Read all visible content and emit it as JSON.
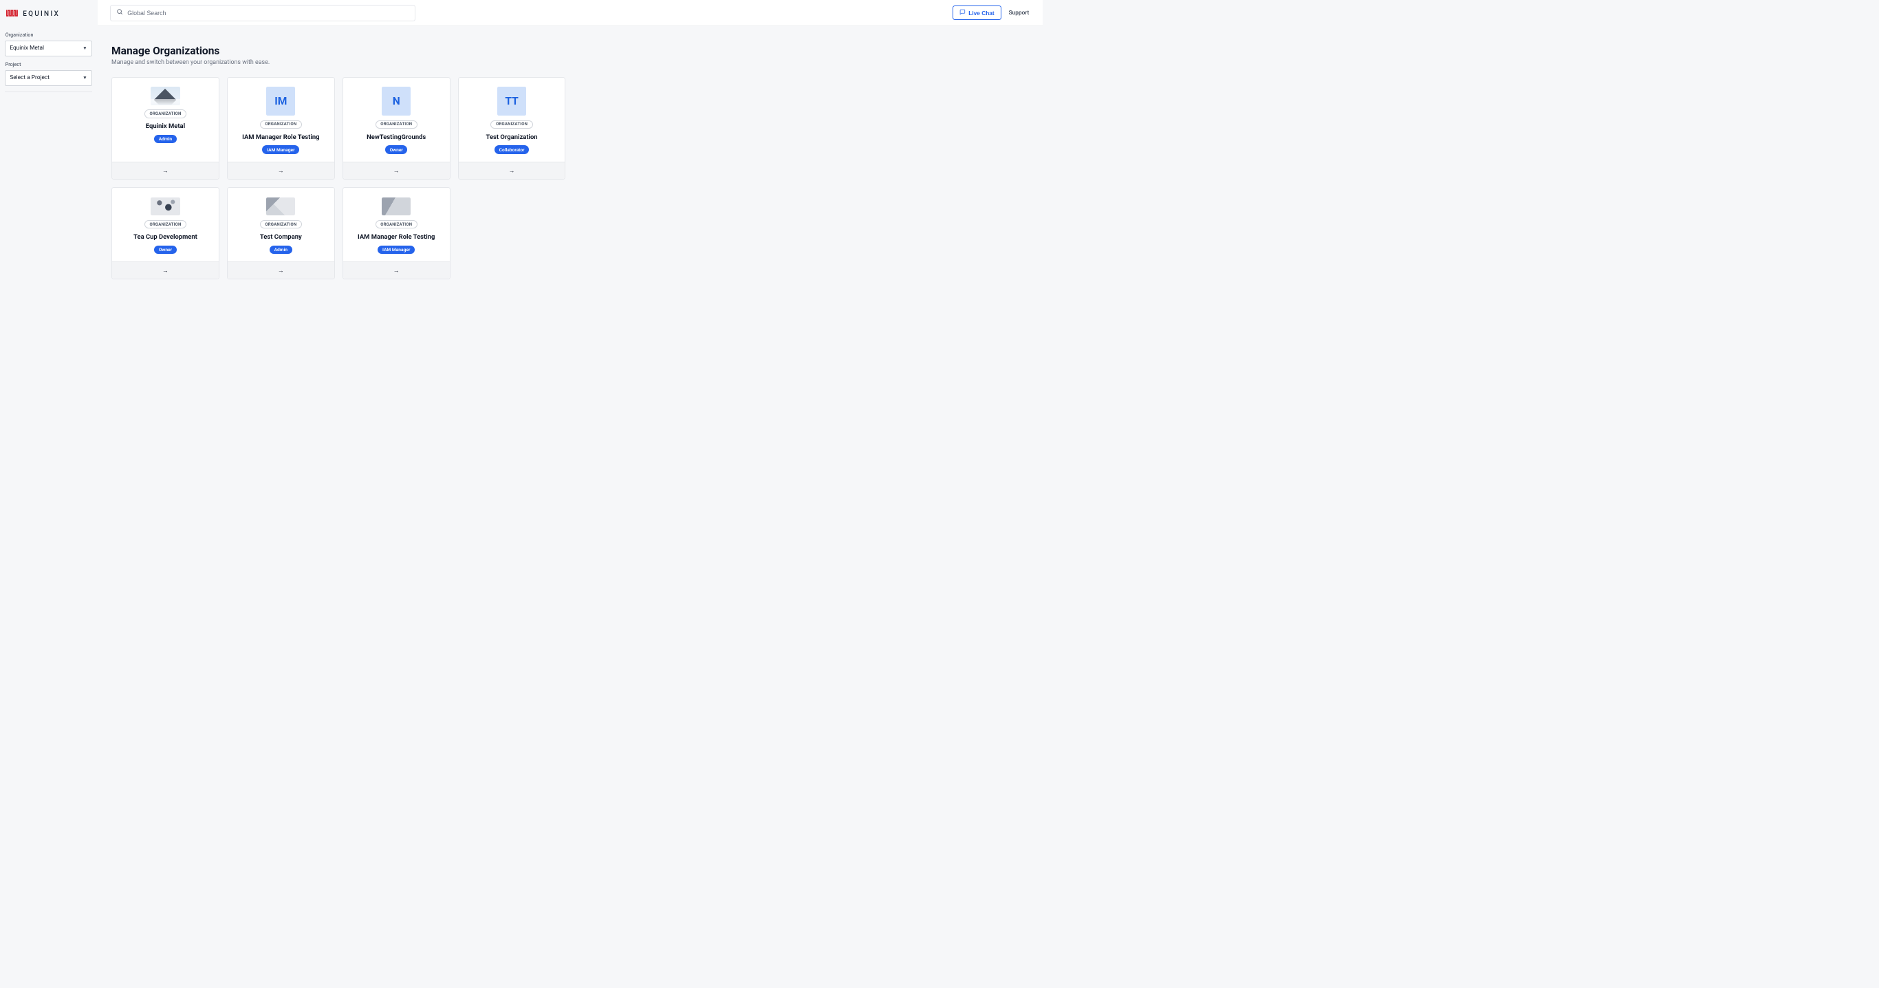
{
  "brand": {
    "name": "EQUINIX"
  },
  "sidebar": {
    "org_label": "Organization",
    "org_selected": "Equinix Metal",
    "project_label": "Project",
    "project_selected": "Select a Project"
  },
  "topbar": {
    "search_placeholder": "Global Search",
    "live_chat": "Live Chat",
    "support": "Support"
  },
  "page": {
    "title": "Manage Organizations",
    "subtitle": "Manage and switch between your organizations with ease."
  },
  "labels": {
    "type_badge": "ORGANIZATION"
  },
  "orgs": [
    {
      "name": "Equinix Metal",
      "role": "Admin",
      "thumb_kind": "image",
      "thumb_class": "mountain",
      "initials": ""
    },
    {
      "name": "IAM Manager Role Testing",
      "role": "IAM Manager",
      "thumb_kind": "initials",
      "thumb_class": "",
      "initials": "IM"
    },
    {
      "name": "NewTestingGrounds",
      "role": "Owner",
      "thumb_kind": "initials",
      "thumb_class": "",
      "initials": "N"
    },
    {
      "name": "Test Organization",
      "role": "Collaborator",
      "thumb_kind": "initials",
      "thumb_class": "",
      "initials": "TT"
    },
    {
      "name": "Tea Cup Development",
      "role": "Owner",
      "thumb_kind": "image",
      "thumb_class": "teacup",
      "initials": ""
    },
    {
      "name": "Test Company",
      "role": "Admin",
      "thumb_kind": "image",
      "thumb_class": "company",
      "initials": ""
    },
    {
      "name": "IAM Manager Role Testing",
      "role": "IAM Manager",
      "thumb_kind": "image",
      "thumb_class": "iam2",
      "initials": ""
    }
  ]
}
